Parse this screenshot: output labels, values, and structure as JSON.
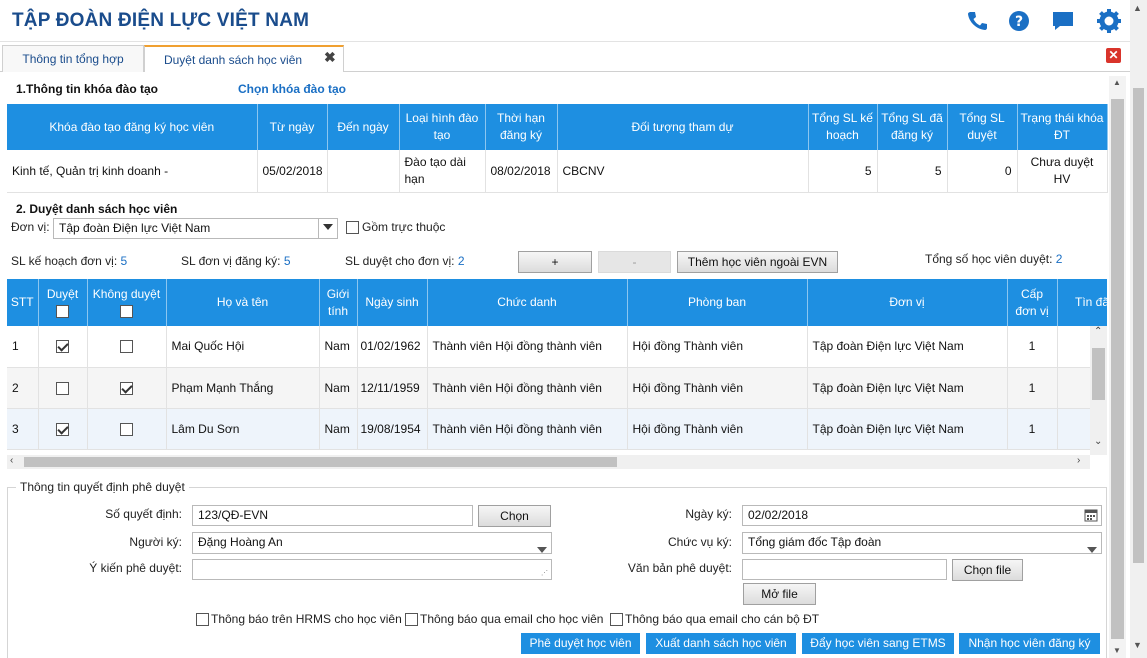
{
  "header": {
    "title": "TẬP ĐOÀN ĐIỆN LỰC VIỆT NAM",
    "icons": [
      "phone-icon",
      "help-icon",
      "chat-icon",
      "gear-icon"
    ]
  },
  "tabs": [
    {
      "label": "Thông tin tổng hợp"
    },
    {
      "label": "Duyệt danh sách học viên"
    }
  ],
  "section1": {
    "title": "1.Thông tin khóa đào tạo",
    "choose_link": "Chọn khóa đào tạo"
  },
  "course_table": {
    "headers": [
      "Khóa đào tạo đăng ký học viên",
      "Từ ngày",
      "Đến ngày",
      "Loại hình đào tạo",
      "Thời hạn đăng ký",
      "Đối tượng tham dự",
      "Tổng SL kế hoạch",
      "Tổng SL đã đăng ký",
      "Tổng SL duyệt",
      "Trạng thái khóa ĐT"
    ],
    "row": [
      "Kinh tế, Quản trị kinh doanh -",
      "05/02/2018",
      "",
      "Đào tạo dài hạn",
      "08/02/2018",
      "CBCNV",
      "5",
      "5",
      "0",
      "Chưa duyệt HV"
    ]
  },
  "section2": {
    "title": "2. Duyệt danh sách học viên",
    "unit_label": "Đơn vị:",
    "unit_value": "Tập đoàn Điện lực Việt Nam",
    "include_sub_label": "Gồm trực thuộc",
    "sl_plan_label": "SL kế hoạch đơn vị:",
    "sl_plan_value": "5",
    "sl_reg_label": "SL đơn vị đăng ký:",
    "sl_reg_value": "5",
    "sl_approve_label": "SL duyệt cho đơn vị:",
    "sl_approve_value": "2",
    "plus_label": "+",
    "minus_label": "-",
    "add_outside_label": "Thêm học viên ngoài EVN",
    "total_label": "Tổng số học viên duyệt:",
    "total_value": "2"
  },
  "student_table": {
    "headers": [
      "STT",
      "Duyệt",
      "Không duyệt",
      "Họ và tên",
      "Giới tính",
      "Ngày sinh",
      "Chức danh",
      "Phòng ban",
      "Đơn vị",
      "Cấp đơn vị",
      "Tìn đã"
    ],
    "rows": [
      {
        "stt": "1",
        "approved": true,
        "rejected": false,
        "name": "Mai Quốc Hội",
        "gender": "Nam",
        "dob": "01/02/1962",
        "title": "Thành viên Hội đồng thành viên",
        "dept": "Hội đồng Thành viên",
        "unit": "Tập đoàn Điện lực Việt Nam",
        "level": "1"
      },
      {
        "stt": "2",
        "approved": false,
        "rejected": true,
        "name": "Phạm Mạnh Thắng",
        "gender": "Nam",
        "dob": "12/11/1959",
        "title": "Thành viên Hội đồng thành viên",
        "dept": "Hội đồng Thành viên",
        "unit": "Tập đoàn Điện lực Việt Nam",
        "level": "1"
      },
      {
        "stt": "3",
        "approved": true,
        "rejected": false,
        "name": "Lâm Du Sơn",
        "gender": "Nam",
        "dob": "19/08/1954",
        "title": "Thành viên Hội đồng thành viên",
        "dept": "Hội đồng Thành viên",
        "unit": "Tập đoàn Điện lực Việt Nam",
        "level": "1"
      }
    ]
  },
  "decision": {
    "legend": "Thông tin quyết định phê duyệt",
    "decision_no_label": "Số quyết định:",
    "decision_no_value": "123/QĐ-EVN",
    "choose_label": "Chọn",
    "sign_date_label": "Ngày ký:",
    "sign_date_value": "02/02/2018",
    "signer_label": "Người ký:",
    "signer_value": "Đặng Hoàng An",
    "position_label": "Chức vụ ký:",
    "position_value": "Tổng giám đốc Tập đoàn",
    "opinion_label": "Ý kiến phê duyệt:",
    "opinion_value": "",
    "doc_label": "Văn bản phê duyệt:",
    "doc_value": "",
    "choose_file_label": "Chọn file",
    "open_file_label": "Mở file",
    "notify_hrms": "Thông báo trên HRMS cho học viên",
    "notify_email_student": "Thông báo qua email cho học viên",
    "notify_email_staff": "Thông báo qua email cho cán bộ ĐT"
  },
  "actions": {
    "approve": "Phê duyệt học viên",
    "export": "Xuất danh sách học viên",
    "push_etms": "Đẩy học viên sang ETMS",
    "receive": "Nhận học viên đăng ký"
  },
  "colors": {
    "brand": "#1a4c8c",
    "header_blue": "#1e8fe1",
    "accent": "#f0a030"
  }
}
